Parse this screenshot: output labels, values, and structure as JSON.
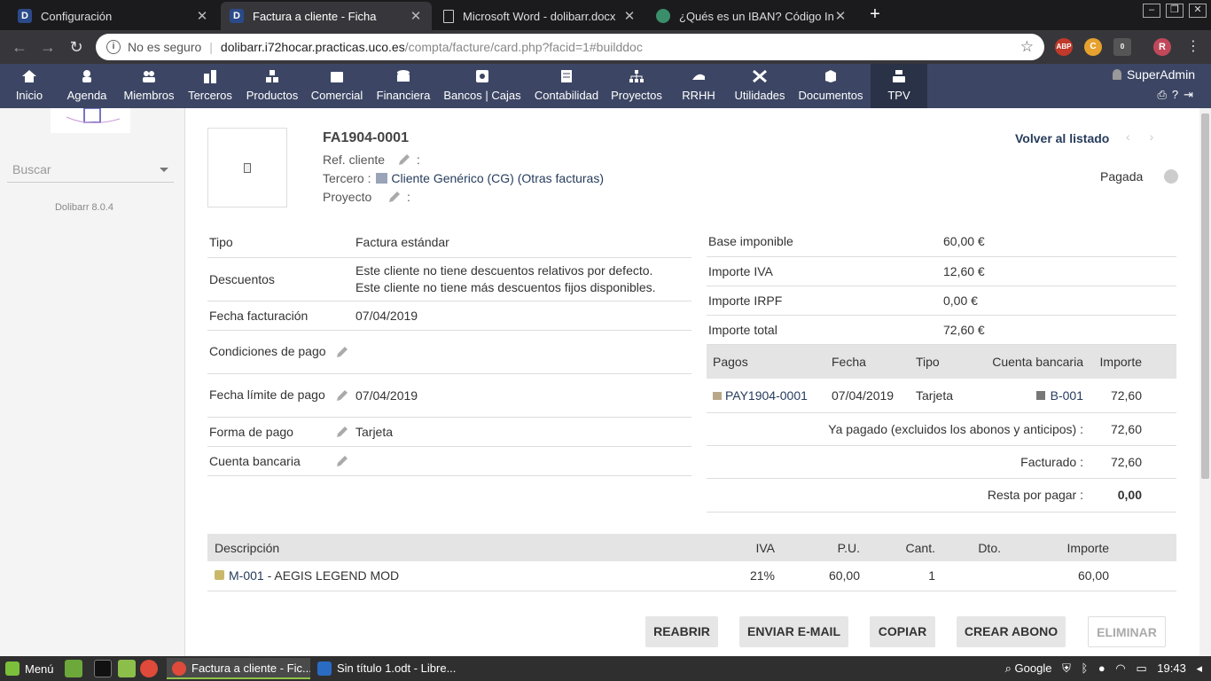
{
  "browser": {
    "tabs": [
      {
        "title": "Configuración",
        "favicon": "D"
      },
      {
        "title": "Factura a cliente - Ficha",
        "favicon": "D"
      },
      {
        "title": "Microsoft Word - dolibarr.docx",
        "favicon": "doc"
      },
      {
        "title": "¿Qués es un IBAN? Código Inter",
        "favicon": "chart"
      }
    ],
    "address": {
      "security_label": "No es seguro",
      "host": "dolibarr.i72hocar.practicas.uco.es",
      "path": "/compta/facture/card.php?facid=1#builddoc"
    },
    "extensions": [
      "ABP",
      "C",
      "0",
      "R"
    ]
  },
  "menu": {
    "items": [
      {
        "label": "Inicio",
        "icon": "home-icon"
      },
      {
        "label": "Agenda",
        "icon": "agenda-icon"
      },
      {
        "label": "Miembros",
        "icon": "members-icon"
      },
      {
        "label": "Terceros",
        "icon": "buildings-icon"
      },
      {
        "label": "Productos",
        "icon": "products-icon"
      },
      {
        "label": "Comercial",
        "icon": "commercial-icon"
      },
      {
        "label": "Financiera",
        "icon": "coins-icon"
      },
      {
        "label": "Bancos | Cajas",
        "icon": "bank-icon"
      },
      {
        "label": "Contabilidad",
        "icon": "accounting-icon"
      },
      {
        "label": "Proyectos",
        "icon": "projects-icon"
      },
      {
        "label": "RRHH",
        "icon": "hr-icon"
      },
      {
        "label": "Utilidades",
        "icon": "tools-icon"
      },
      {
        "label": "Documentos",
        "icon": "documents-icon"
      },
      {
        "label": "TPV",
        "icon": "pos-icon"
      }
    ],
    "user": "SuperAdmin"
  },
  "sidebar": {
    "search_placeholder": "Buscar",
    "version": "Dolibarr 8.0.4"
  },
  "invoice": {
    "ref": "FA1904-0001",
    "ref_cliente_label": "Ref. cliente",
    "tercero_label": "Tercero :",
    "tercero_value": "Cliente Genérico (CG)",
    "otras_facturas": "(Otras facturas)",
    "proyecto_label": "Proyecto",
    "colon": ":",
    "back_label": "Volver al listado",
    "status": "Pagada"
  },
  "details": [
    {
      "label": "Tipo",
      "value": "Factura estándar"
    },
    {
      "label": "Descuentos",
      "value": "Este cliente no tiene descuentos relativos por defecto.",
      "value2": "Este cliente no tiene más descuentos fijos disponibles."
    },
    {
      "label": "Fecha facturación",
      "value": "07/04/2019"
    },
    {
      "label": "Condiciones de pago",
      "value": ""
    },
    {
      "label": "Fecha límite de pago",
      "value": "07/04/2019"
    },
    {
      "label": "Forma de pago",
      "value": "Tarjeta"
    },
    {
      "label": "Cuenta bancaria",
      "value": ""
    }
  ],
  "amounts": [
    {
      "label": "Base imponible",
      "value": "60,00 €"
    },
    {
      "label": "Importe IVA",
      "value": "12,60 €"
    },
    {
      "label": "Importe IRPF",
      "value": "0,00 €"
    },
    {
      "label": "Importe total",
      "value": "72,60 €"
    }
  ],
  "payments": {
    "headers": [
      "Pagos",
      "Fecha",
      "Tipo",
      "Cuenta bancaria",
      "Importe"
    ],
    "rows": [
      {
        "ref": "PAY1904-0001",
        "date": "07/04/2019",
        "type": "Tarjeta",
        "account": "B-001",
        "amount": "72,60"
      }
    ],
    "ya_pagado_label": "Ya pagado (excluidos los abonos y anticipos) :",
    "ya_pagado_value": "72,60",
    "facturado_label": "Facturado :",
    "facturado_value": "72,60",
    "resta_label": "Resta por pagar :",
    "resta_value": "0,00"
  },
  "lines": {
    "headers": [
      "Descripción",
      "IVA",
      "P.U.",
      "Cant.",
      "Dto.",
      "Importe"
    ],
    "rows": [
      {
        "ref": "M-001",
        "desc": " - AEGIS LEGEND MOD",
        "iva": "21%",
        "pu": "60,00",
        "qty": "1",
        "dto": "",
        "importe": "60,00"
      }
    ]
  },
  "actions": [
    "REABRIR",
    "ENVIAR E-MAIL",
    "COPIAR",
    "CREAR ABONO",
    "ELIMINAR"
  ],
  "taskbar": {
    "menu_label": "Menú",
    "windows": [
      "Factura a cliente - Fic...",
      "Sin título 1.odt - Libre..."
    ],
    "search_label": "Google",
    "clock": "19:43"
  },
  "colors": {
    "menu_bg": "#3c4664",
    "link": "#263c5c",
    "paid_green": "#5b8f2a"
  }
}
